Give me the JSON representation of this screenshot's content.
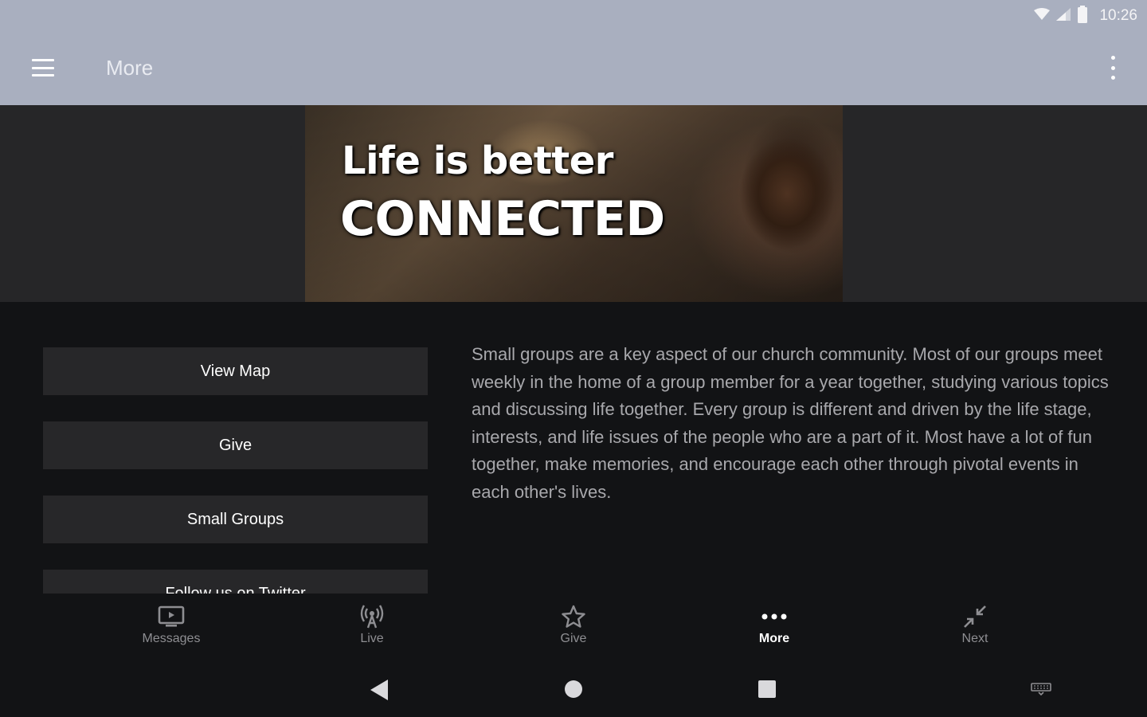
{
  "status_bar": {
    "time": "10:26"
  },
  "app_bar": {
    "title": "More"
  },
  "hero": {
    "line1": "Life is better",
    "line2": "CONNECTED"
  },
  "buttons": {
    "view_map": "View Map",
    "give": "Give",
    "small_groups": "Small Groups",
    "twitter": "Follow us on Twitter"
  },
  "description": "Small groups are a key aspect of our church community. Most of our groups meet weekly in the home of a group member for a year together, studying various topics and discussing life together. Every group is different and driven by the life stage, interests, and life issues of the people who are a part of it. Most have a lot of fun together, make memories, and encourage each other through pivotal events in each other's lives.",
  "bottom_nav": {
    "items": [
      {
        "label": "Messages",
        "icon": "tv-icon"
      },
      {
        "label": "Live",
        "icon": "broadcast-icon"
      },
      {
        "label": "Give",
        "icon": "star-icon"
      },
      {
        "label": "More",
        "icon": "more-dots-icon",
        "active": true
      },
      {
        "label": "Next",
        "icon": "collapse-arrows-icon"
      }
    ]
  },
  "colors": {
    "app_bar": "#a9afbf",
    "background": "#121315",
    "button": "#272729",
    "description_text": "#a8a8ac"
  }
}
